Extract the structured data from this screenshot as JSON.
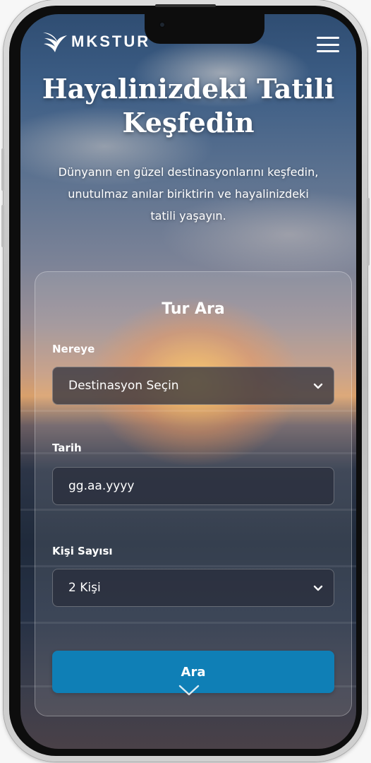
{
  "brand": {
    "logo_text": "MKSTUR"
  },
  "hero": {
    "title_line1": "Hayalinizdeki Tatili",
    "title_line2": "Keşfedin",
    "subtitle_line1": "Dünyanın en güzel destinasyonlarını keşfedin,",
    "subtitle_line2": "unutulmaz anılar biriktirin ve hayalinizdeki",
    "subtitle_line3": "tatili yaşayın."
  },
  "search_form": {
    "title": "Tur Ara",
    "destination_label": "Nereye",
    "destination_value": "Destinasyon Seçin",
    "date_label": "Tarih",
    "date_value": "gg.aa.yyyy",
    "people_label": "Kişi Sayısı",
    "people_value": "2 Kişi",
    "submit_label": "Ara"
  },
  "icons": {
    "menu": "hamburger-menu-icon",
    "logo": "wing-logo-icon",
    "select": "chevron-down-icon",
    "scroll": "chevron-down-icon"
  },
  "colors": {
    "accent": "#0f7fb6",
    "text": "#ffffff"
  }
}
